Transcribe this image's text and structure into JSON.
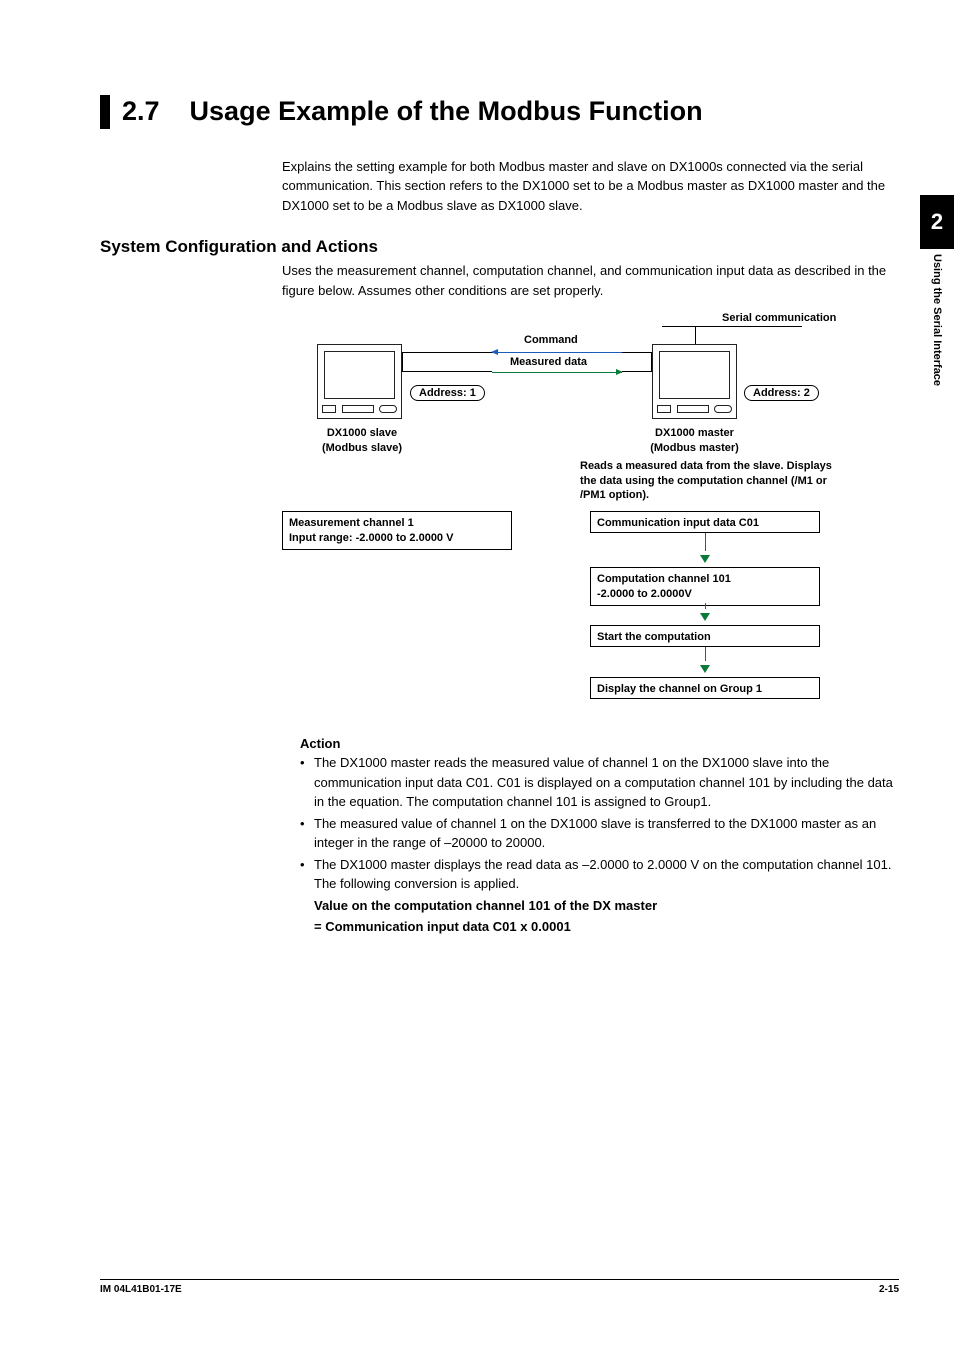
{
  "side": {
    "chapter_num": "2",
    "chapter_label": "Using the Serial Interface"
  },
  "heading": {
    "number": "2.7",
    "title": "Usage Example of the Modbus Function"
  },
  "intro": "Explains the setting example for both Modbus master and slave on DX1000s connected via the serial communication. This section refers to the DX1000 set to be a Modbus master as DX1000 master and the DX1000 set to be a Modbus slave as DX1000 slave.",
  "section": {
    "title": "System Configuration and Actions",
    "body": "Uses the measurement channel, computation channel, and communication input data as described in the figure below. Assumes other conditions are set properly."
  },
  "diagram": {
    "serial_label": "Serial communication",
    "command_label": "Command",
    "measured_label": "Measured data",
    "addr1": "Address: 1",
    "addr2": "Address: 2",
    "slave_name": "DX1000 slave",
    "slave_sub": "(Modbus slave)",
    "master_name": "DX1000 master",
    "master_sub": "(Modbus master)",
    "master_note": "Reads a measured data from the slave. Displays the data using the computation channel (/M1 or /PM1 option).",
    "slave_box_l1": "Measurement channel 1",
    "slave_box_l2": "Input range: -2.0000 to 2.0000 V",
    "flow1": "Communication input data C01",
    "flow2_l1": "Computation channel 101",
    "flow2_l2": "-2.0000 to 2.0000V",
    "flow3": "Start the computation",
    "flow4": "Display the channel on Group 1"
  },
  "action": {
    "title": "Action",
    "bullets": [
      "The DX1000 master reads the measured value of channel 1 on the DX1000 slave into the communication input data C01. C01 is displayed on a computation channel 101 by including the data in the equation. The computation channel 101 is assigned to Group1.",
      "The measured value of channel 1 on the DX1000 slave is transferred to the DX1000 master as an integer in the range of –20000 to 20000.",
      "The DX1000 master displays the read data as –2.0000 to 2.0000 V on the computation channel 101. The following conversion is applied."
    ],
    "formula_l1": "Value on the computation channel 101 of the DX master",
    "formula_l2": "= Communication input data C01 x 0.0001"
  },
  "footer": {
    "left": "IM 04L41B01-17E",
    "right": "2-15"
  }
}
